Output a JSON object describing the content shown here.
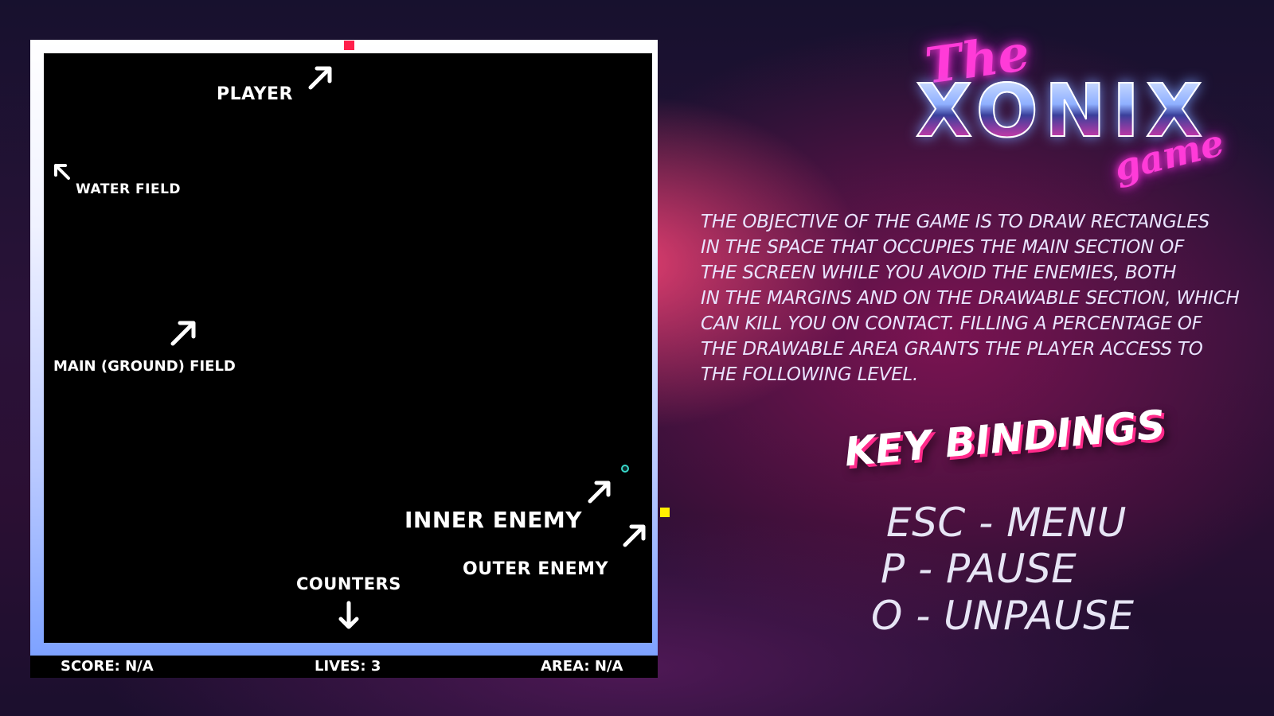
{
  "board": {
    "labels": {
      "player": "PLAYER",
      "water_field": "WATER FIELD",
      "main_field": "MAIN (GROUND) FIELD",
      "inner_enemy": "INNER ENEMY",
      "outer_enemy": "OUTER ENEMY",
      "counters": "COUNTERS"
    },
    "counters": {
      "score": "SCORE: N/A",
      "lives": "LIVES: 3",
      "area": "AREA: N/A"
    },
    "colors": {
      "player": "#ff1f4b",
      "outer_enemy": "#ffee00",
      "inner_enemy": "#38d7c8",
      "field": "#000000"
    }
  },
  "logo": {
    "the": "The",
    "xonix": "XONIX",
    "game": "game"
  },
  "description": [
    "THE OBJECTIVE OF THE GAME IS TO DRAW RECTANGLES",
    "IN THE SPACE THAT OCCUPIES THE MAIN SECTION OF",
    "THE SCREEN WHILE YOU AVOID THE ENEMIES, BOTH",
    "IN THE MARGINS AND ON THE DRAWABLE SECTION, WHICH",
    "CAN KILL YOU ON CONTACT. FILLING A PERCENTAGE OF",
    "THE DRAWABLE AREA GRANTS THE PLAYER ACCESS TO",
    "THE FOLLOWING LEVEL."
  ],
  "key_bindings": {
    "title": "KEY BINDINGS",
    "items": [
      "ESC - MENU",
      "P - PAUSE",
      "O - UNPAUSE"
    ]
  }
}
